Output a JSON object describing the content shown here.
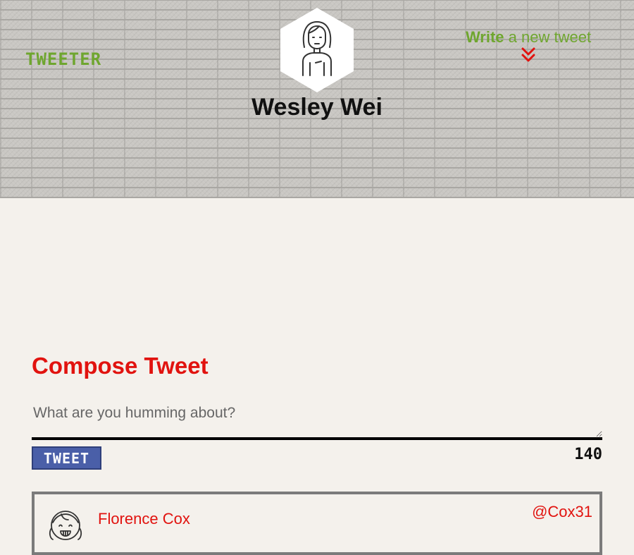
{
  "header": {
    "brand": "TWEETER",
    "user_name": "Wesley Wei",
    "write_link": {
      "strong": "Write",
      "rest": " a new tweet",
      "icon": "chevrons-down-icon"
    },
    "avatar_icon": "woman-avatar-icon"
  },
  "compose": {
    "title": "Compose Tweet",
    "placeholder": "What are you humming about?",
    "button_label": "TWEET",
    "counter": "140"
  },
  "tweets": [
    {
      "name": "Florence Cox",
      "handle": "@Cox31",
      "avatar_icon": "girl-avatar-icon"
    }
  ],
  "colors": {
    "accent_red": "#e1130f",
    "brand_green": "#6fa62f",
    "button_blue": "#4a5fa8"
  }
}
